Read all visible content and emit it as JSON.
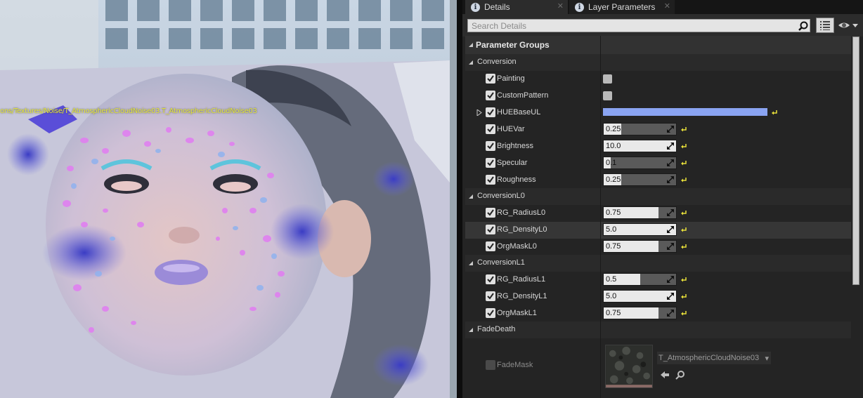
{
  "viewport": {
    "asset_path": "ons/Textures/Noise/T_AtmosphericCloudNoise03.T_AtmosphericCloudNoise03"
  },
  "tabs": [
    {
      "label": "Details",
      "icon": "info-icon",
      "active": true
    },
    {
      "label": "Layer Parameters",
      "icon": "info-icon",
      "active": false
    }
  ],
  "search": {
    "placeholder": "Search Details"
  },
  "tree": {
    "header": "Parameter Groups",
    "groups": [
      {
        "name": "Conversion",
        "params": [
          {
            "label": "Painting",
            "type": "bool",
            "value": ""
          },
          {
            "label": "CustomPattern",
            "type": "bool",
            "value": ""
          },
          {
            "label": "HUEBaseUL",
            "type": "color",
            "color": "#8aa4f2"
          },
          {
            "label": "HUEVar",
            "type": "number",
            "value": "0.25"
          },
          {
            "label": "Brightness",
            "type": "number",
            "value": "10.0"
          },
          {
            "label": "Specular",
            "type": "number",
            "value": "0.1"
          },
          {
            "label": "Roughness",
            "type": "number",
            "value": "0.25"
          }
        ]
      },
      {
        "name": "ConversionL0",
        "params": [
          {
            "label": "RG_RadiusL0",
            "type": "number",
            "value": "0.75"
          },
          {
            "label": "RG_DensityL0",
            "type": "number",
            "value": "5.0"
          },
          {
            "label": "OrgMaskL0",
            "type": "number",
            "value": "0.75"
          }
        ]
      },
      {
        "name": "ConversionL1",
        "params": [
          {
            "label": "RG_RadiusL1",
            "type": "number",
            "value": "0.5"
          },
          {
            "label": "RG_DensityL1",
            "type": "number",
            "value": "5.0"
          },
          {
            "label": "OrgMaskL1",
            "type": "number",
            "value": "0.75"
          }
        ]
      },
      {
        "name": "FadeDeath",
        "params": [
          {
            "label": "FadeMask",
            "type": "texture",
            "texture": "T_AtmosphericCloudNoise03"
          }
        ]
      }
    ]
  },
  "colors": {
    "accent_reset": "#e8e03a",
    "hue_base": "#8aa4f2"
  }
}
